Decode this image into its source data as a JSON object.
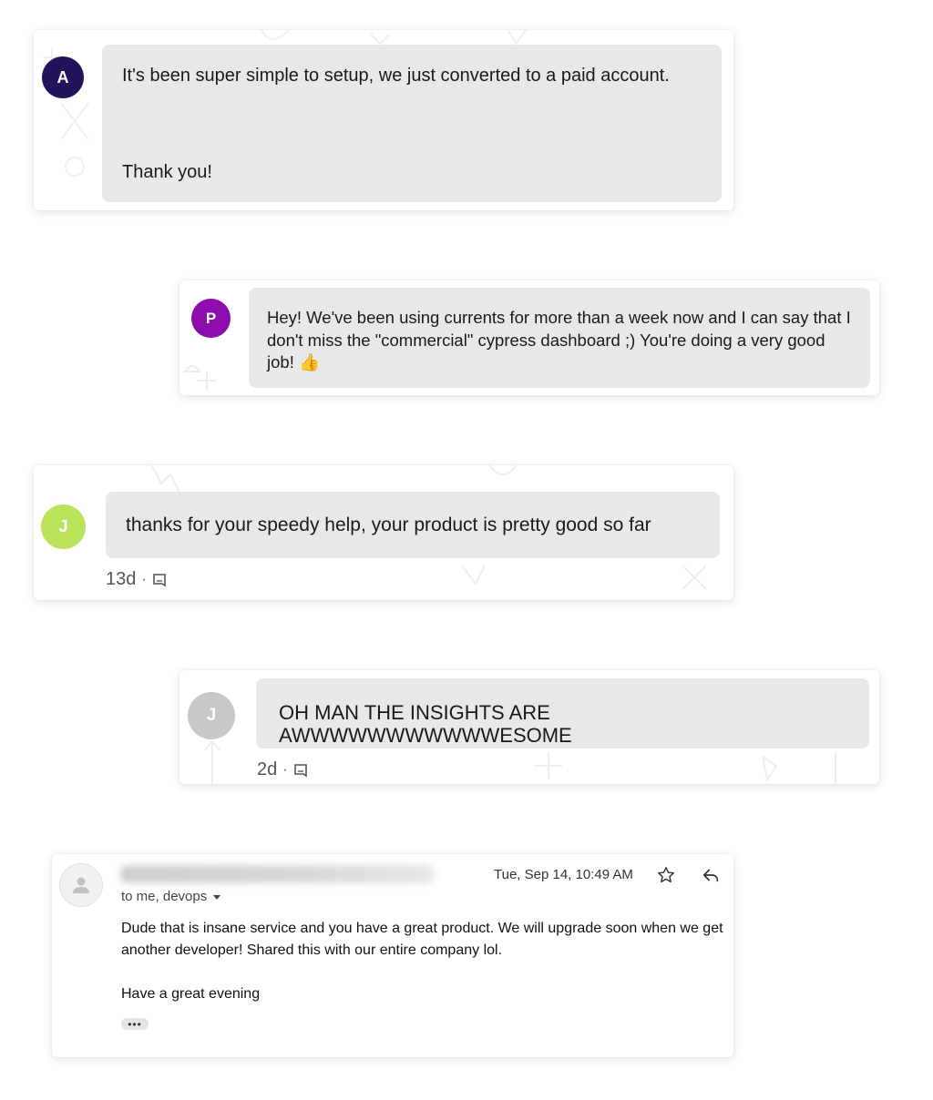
{
  "messages": [
    {
      "avatar": {
        "initial": "A",
        "color": "#23135a"
      },
      "lines": [
        "It's been super simple to setup, we just converted to a paid account.",
        "Thank you!"
      ]
    },
    {
      "avatar": {
        "initial": "P",
        "color": "#8d0cad"
      },
      "text": "Hey! We've been using currents for more than a week now and I can say that I don't miss the \"commercial\" cypress dashboard ;) You're doing a very good job! 👍"
    },
    {
      "avatar": {
        "initial": "J",
        "color": "#b9e35b"
      },
      "text": "thanks for your speedy help, your product is pretty good so far",
      "time": "13d",
      "separator": "·",
      "icon": "comment-icon"
    },
    {
      "avatar": {
        "initial": "J",
        "color": "#c8c8c8"
      },
      "text": "OH MAN THE INSIGHTS ARE AWWWWWWWWWWWESOME",
      "time": "2d",
      "separator": "·",
      "icon": "comment-icon"
    }
  ],
  "email": {
    "date": "Tue, Sep 14, 10:49 AM",
    "to": "to me, devops",
    "body_line1": "Dude that is insane service and you have a great product. We will upgrade soon when we get another developer! Shared this with our entire company lol.",
    "body_line2": "Have a great evening",
    "ellipsis": "•••",
    "icons": [
      "person-icon",
      "star-icon",
      "reply-icon",
      "caret-down-icon"
    ]
  }
}
